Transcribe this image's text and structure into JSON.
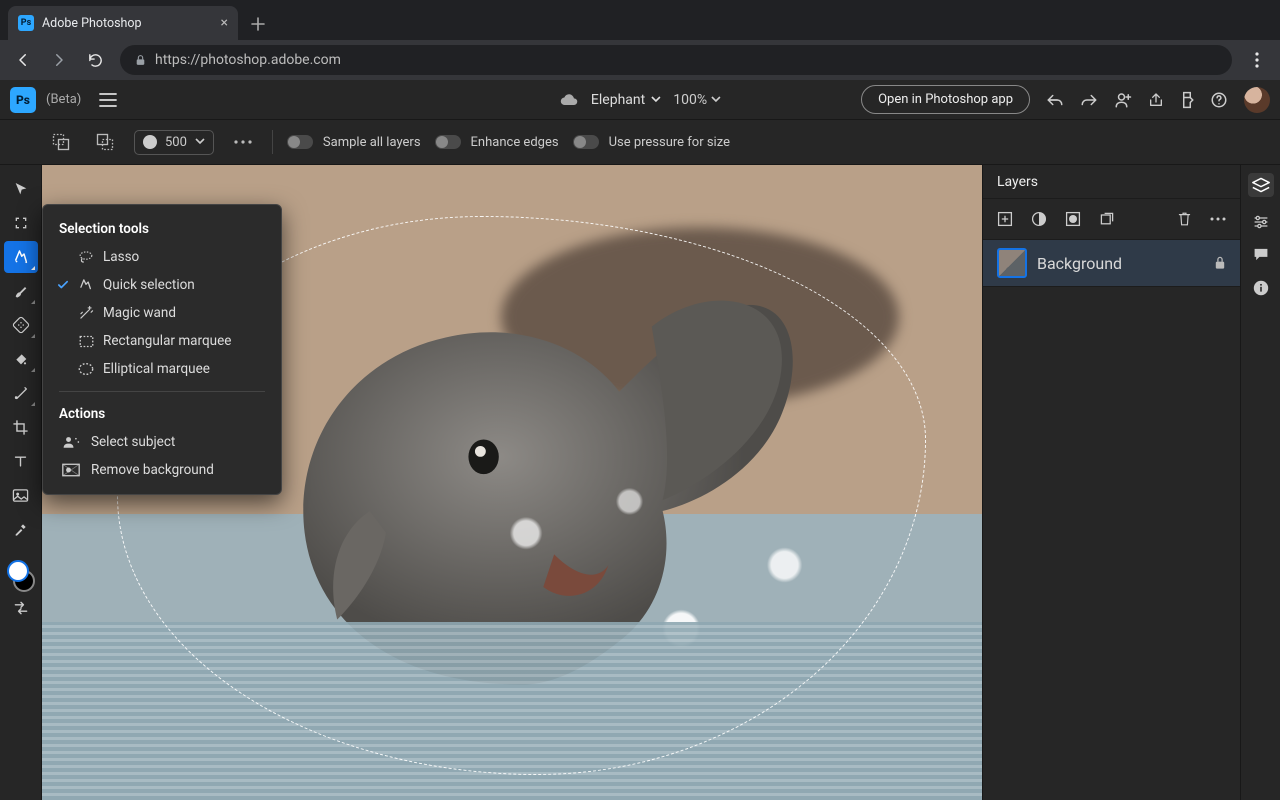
{
  "browser": {
    "tab_title": "Adobe Photoshop",
    "url": "https://photoshop.adobe.com"
  },
  "app": {
    "logo_text": "Ps",
    "beta_label": "(Beta)",
    "document_name": "Elephant",
    "zoom": "100%",
    "open_in_app": "Open in Photoshop app"
  },
  "options": {
    "brush_size": "500",
    "sample_all_layers": "Sample all layers",
    "enhance_edges": "Enhance edges",
    "use_pressure": "Use pressure for size"
  },
  "flyout": {
    "section_selection": "Selection tools",
    "lasso": "Lasso",
    "quick_selection": "Quick selection",
    "magic_wand": "Magic wand",
    "rect_marquee": "Rectangular marquee",
    "ellipse_marquee": "Elliptical marquee",
    "section_actions": "Actions",
    "select_subject": "Select subject",
    "remove_bg": "Remove background"
  },
  "layers": {
    "title": "Layers",
    "background": "Background"
  }
}
